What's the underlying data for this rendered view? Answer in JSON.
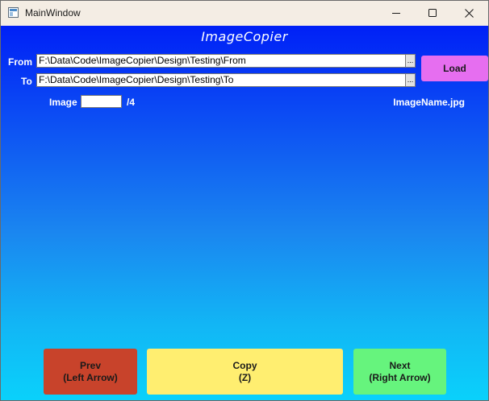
{
  "window": {
    "title": "MainWindow",
    "icon": "app-window-icon",
    "controls": [
      "minimize-icon",
      "maximize-icon",
      "close-icon"
    ]
  },
  "app": {
    "title": "ImageCopier"
  },
  "paths": {
    "from_label": "From",
    "from_value": "F:\\Data\\Code\\ImageCopier\\Design\\Testing\\From",
    "to_label": "To",
    "to_value": "F:\\Data\\Code\\ImageCopier\\Design\\Testing\\To",
    "browse_label": "..."
  },
  "load_button": "Load",
  "image_info": {
    "label": "Image",
    "index_value": "",
    "total": "/4",
    "file_name": "ImageName.jpg"
  },
  "actions": {
    "prev_line1": "Prev",
    "prev_line2": "(Left Arrow)",
    "copy_line1": "Copy",
    "copy_line2": "(Z)",
    "next_line1": "Next",
    "next_line2": "(Right Arrow)"
  },
  "colors": {
    "background_top": "#0020f6",
    "background_bottom": "#0ad1fb",
    "load_button": "#e66ef0",
    "prev_button": "#c8432b",
    "copy_button": "#ffee70",
    "next_button": "#66f47d"
  }
}
